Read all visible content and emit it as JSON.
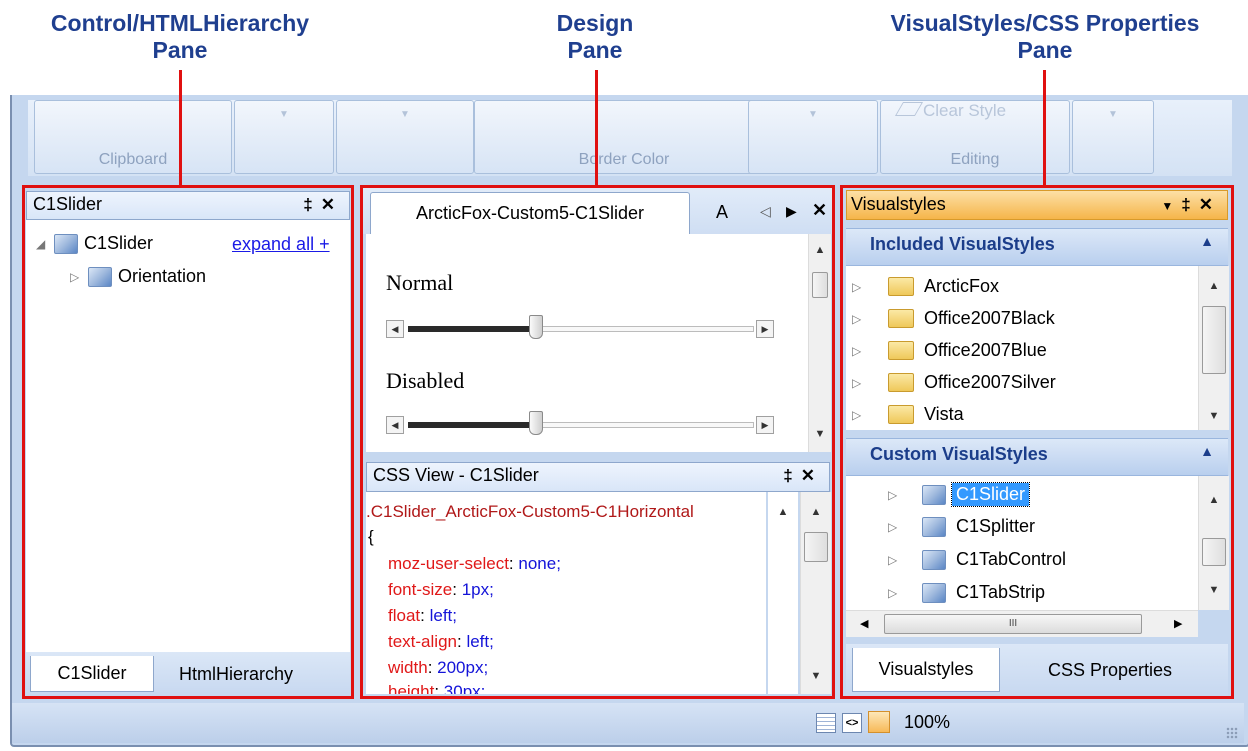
{
  "callouts": {
    "left_line1": "Control/HTMLHierarchy",
    "left_line2": "Pane",
    "middle_line1": "Design",
    "middle_line2": "Pane",
    "right_line1": "VisualStyles/CSS Properties",
    "right_line2": "Pane"
  },
  "ribbon": {
    "groups": [
      {
        "label": "Clipboard"
      },
      {
        "label": ""
      },
      {
        "label": ""
      },
      {
        "label": "Border Color"
      },
      {
        "label": ""
      },
      {
        "label": "Editing"
      },
      {
        "label": ""
      }
    ],
    "clear_style": "Clear Style"
  },
  "left_pane": {
    "title": "C1Slider",
    "pin_glyph": "‡",
    "close_glyph": "✕",
    "tree": [
      {
        "label": "C1Slider",
        "expander": "◢"
      },
      {
        "label": "Orientation",
        "expander": "▷"
      }
    ],
    "expand_all": "expand all +",
    "tabs": [
      "C1Slider",
      "HtmlHierarchy"
    ]
  },
  "design_pane": {
    "tab_active": "ArcticFox-Custom5-C1Slider",
    "tab_next": "A",
    "nav_left": "◁",
    "nav_right": "▶",
    "close_glyph": "✕",
    "normal_label": "Normal",
    "disabled_label": "Disabled",
    "normal_slider_value_pct": 37,
    "disabled_slider_value_pct": 37
  },
  "css_view": {
    "title": "CSS View - C1Slider",
    "pin_glyph": "‡",
    "close_glyph": "✕",
    "selector": ".C1Slider_ArcticFox-Custom5-C1Horizontal",
    "brace": "{",
    "rules": [
      {
        "prop": "moz-user-select",
        "val": "none;"
      },
      {
        "prop": "font-size",
        "val": "1px;"
      },
      {
        "prop": "float",
        "val": "left;"
      },
      {
        "prop": "text-align",
        "val": "left;"
      },
      {
        "prop": "width",
        "val": "200px;"
      },
      {
        "prop": "height",
        "val": "30px;"
      }
    ]
  },
  "right_pane": {
    "title": "Visualstyles",
    "dropdown_glyph": "▼",
    "pin_glyph": "‡",
    "close_glyph": "✕",
    "included_header": "Included VisualStyles",
    "included_items": [
      "ArcticFox",
      "Office2007Black",
      "Office2007Blue",
      "Office2007Silver",
      "Vista"
    ],
    "custom_header": "Custom VisualStyles",
    "custom_items": [
      "C1Slider",
      "C1Splitter",
      "C1TabControl",
      "C1TabStrip"
    ],
    "selected_custom": "C1Slider",
    "tabs": [
      "Visualstyles",
      "CSS Properties"
    ]
  },
  "status_bar": {
    "zoom": "100%"
  },
  "colors": {
    "callout_text": "#1f3f8f",
    "highlight_red": "#e01010",
    "selection_blue": "#3399ff",
    "visualstyles_header": "#f7b64a"
  }
}
